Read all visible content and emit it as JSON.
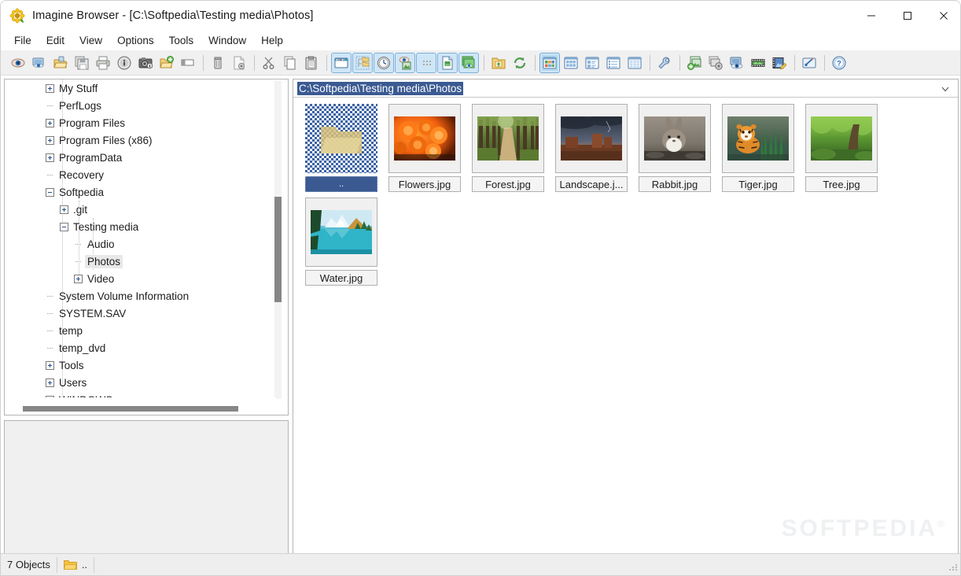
{
  "window": {
    "title": "Imagine Browser - [C:\\Softpedia\\Testing media\\Photos]",
    "app_icon": "sunflower-icon",
    "minimize_label": "—",
    "maximize_label": "□",
    "close_label": "✕"
  },
  "menubar": {
    "items": [
      {
        "label": "File"
      },
      {
        "label": "Edit"
      },
      {
        "label": "View"
      },
      {
        "label": "Options"
      },
      {
        "label": "Tools"
      },
      {
        "label": "Window"
      },
      {
        "label": "Help"
      }
    ]
  },
  "toolbar": {
    "groups": [
      {
        "buttons": [
          {
            "icon": "eye-preview-icon",
            "state": "normal"
          },
          {
            "icon": "slideshow-screen-icon",
            "state": "normal"
          },
          {
            "icon": "open-folder-icon",
            "state": "normal"
          },
          {
            "icon": "save-copy-icon",
            "state": "normal"
          },
          {
            "icon": "print-icon",
            "state": "normal"
          },
          {
            "icon": "info-icon",
            "state": "normal"
          },
          {
            "icon": "camera-info-icon",
            "state": "normal"
          },
          {
            "icon": "new-folder-icon",
            "state": "normal"
          },
          {
            "icon": "rename-icon",
            "state": "normal"
          },
          {
            "icon": "delete-bin-icon",
            "state": "normal"
          },
          {
            "icon": "file-properties-icon",
            "state": "normal"
          }
        ]
      },
      {
        "buttons": [
          {
            "icon": "cut-scissors-icon",
            "state": "normal"
          },
          {
            "icon": "copy-icon",
            "state": "normal"
          },
          {
            "icon": "paste-icon",
            "state": "normal"
          }
        ]
      },
      {
        "buttons": [
          {
            "icon": "window-view-icon",
            "state": "on"
          },
          {
            "icon": "folder-list-icon",
            "state": "on"
          },
          {
            "icon": "clock-icon",
            "state": "on"
          },
          {
            "icon": "preview-pane-icon",
            "state": "on"
          },
          {
            "icon": "dotted-grid-icon",
            "state": "on"
          },
          {
            "icon": "file-details-icon",
            "state": "on"
          },
          {
            "icon": "stacked-images-icon",
            "state": "on"
          }
        ]
      },
      {
        "buttons": [
          {
            "icon": "import-folder-icon",
            "state": "normal"
          },
          {
            "icon": "refresh-icon",
            "state": "normal"
          }
        ]
      },
      {
        "buttons": [
          {
            "icon": "view-thumbnails-icon",
            "state": "pressed"
          },
          {
            "icon": "view-tiles-icon",
            "state": "normal"
          },
          {
            "icon": "view-icons-icon",
            "state": "normal"
          },
          {
            "icon": "view-list-icon",
            "state": "normal"
          },
          {
            "icon": "view-details-icon",
            "state": "normal"
          }
        ]
      },
      {
        "buttons": [
          {
            "icon": "wrench-tools-icon",
            "state": "normal"
          }
        ]
      },
      {
        "buttons": [
          {
            "icon": "batch-add-icon",
            "state": "normal"
          },
          {
            "icon": "batch-settings-icon",
            "state": "normal"
          },
          {
            "icon": "screen-capture-icon",
            "state": "normal"
          },
          {
            "icon": "filmstrip-icon",
            "state": "normal"
          },
          {
            "icon": "edit-film-icon",
            "state": "normal"
          }
        ]
      },
      {
        "buttons": [
          {
            "icon": "plugin-link-icon",
            "state": "normal"
          }
        ]
      },
      {
        "buttons": [
          {
            "icon": "help-icon",
            "state": "normal"
          }
        ]
      }
    ]
  },
  "tree": {
    "items": [
      {
        "label": "My Stuff",
        "depth": 1,
        "marker": "plus",
        "selected": false
      },
      {
        "label": "PerfLogs",
        "depth": 1,
        "marker": "dash",
        "selected": false
      },
      {
        "label": "Program Files",
        "depth": 1,
        "marker": "plus",
        "selected": false
      },
      {
        "label": "Program Files (x86)",
        "depth": 1,
        "marker": "plus",
        "selected": false
      },
      {
        "label": "ProgramData",
        "depth": 1,
        "marker": "plus",
        "selected": false
      },
      {
        "label": "Recovery",
        "depth": 1,
        "marker": "dash",
        "selected": false
      },
      {
        "label": "Softpedia",
        "depth": 1,
        "marker": "minus",
        "selected": false
      },
      {
        "label": ".git",
        "depth": 2,
        "marker": "plus",
        "selected": false
      },
      {
        "label": "Testing media",
        "depth": 2,
        "marker": "minus",
        "selected": false
      },
      {
        "label": "Audio",
        "depth": 3,
        "marker": "dash",
        "selected": false
      },
      {
        "label": "Photos",
        "depth": 3,
        "marker": "dash",
        "selected": true
      },
      {
        "label": "Video",
        "depth": 3,
        "marker": "plus",
        "selected": false
      },
      {
        "label": "System Volume Information",
        "depth": 1,
        "marker": "dash",
        "selected": false
      },
      {
        "label": "SYSTEM.SAV",
        "depth": 1,
        "marker": "dash",
        "selected": false
      },
      {
        "label": "temp",
        "depth": 1,
        "marker": "dash",
        "selected": false
      },
      {
        "label": "temp_dvd",
        "depth": 1,
        "marker": "dash",
        "selected": false
      },
      {
        "label": "Tools",
        "depth": 1,
        "marker": "plus",
        "selected": false
      },
      {
        "label": "Users",
        "depth": 1,
        "marker": "plus",
        "selected": false
      },
      {
        "label": "WINDOWS",
        "depth": 1,
        "marker": "plus",
        "selected": false
      }
    ]
  },
  "content": {
    "path_value": "C:\\Softpedia\\Testing media\\Photos",
    "dropdown_icon": "chevron-down-icon",
    "items": [
      {
        "name": "..",
        "type": "parent-folder",
        "selected": true,
        "thumb": "folder"
      },
      {
        "name": "Flowers.jpg",
        "type": "image",
        "selected": false,
        "thumb": "flowers"
      },
      {
        "name": "Forest.jpg",
        "type": "image",
        "selected": false,
        "thumb": "forest"
      },
      {
        "name": "Landscape.j...",
        "type": "image",
        "selected": false,
        "thumb": "landscape"
      },
      {
        "name": "Rabbit.jpg",
        "type": "image",
        "selected": false,
        "thumb": "rabbit"
      },
      {
        "name": "Tiger.jpg",
        "type": "image",
        "selected": false,
        "thumb": "tiger"
      },
      {
        "name": "Tree.jpg",
        "type": "image",
        "selected": false,
        "thumb": "tree"
      },
      {
        "name": "Water.jpg",
        "type": "image",
        "selected": false,
        "thumb": "water"
      }
    ]
  },
  "statusbar": {
    "object_count": "7 Objects",
    "selected_icon": "folder-icon",
    "selected_name": ".."
  },
  "watermark": {
    "text": "SOFTPEDIA",
    "mark": "®"
  },
  "colors": {
    "selection_blue": "#3b5a92",
    "toolbar_bg": "#f0f0f0",
    "panel_border": "#b4b4b4",
    "tree_selected_bg": "#e8e8e8",
    "toggle_on_bg": "#cfe6f7"
  }
}
